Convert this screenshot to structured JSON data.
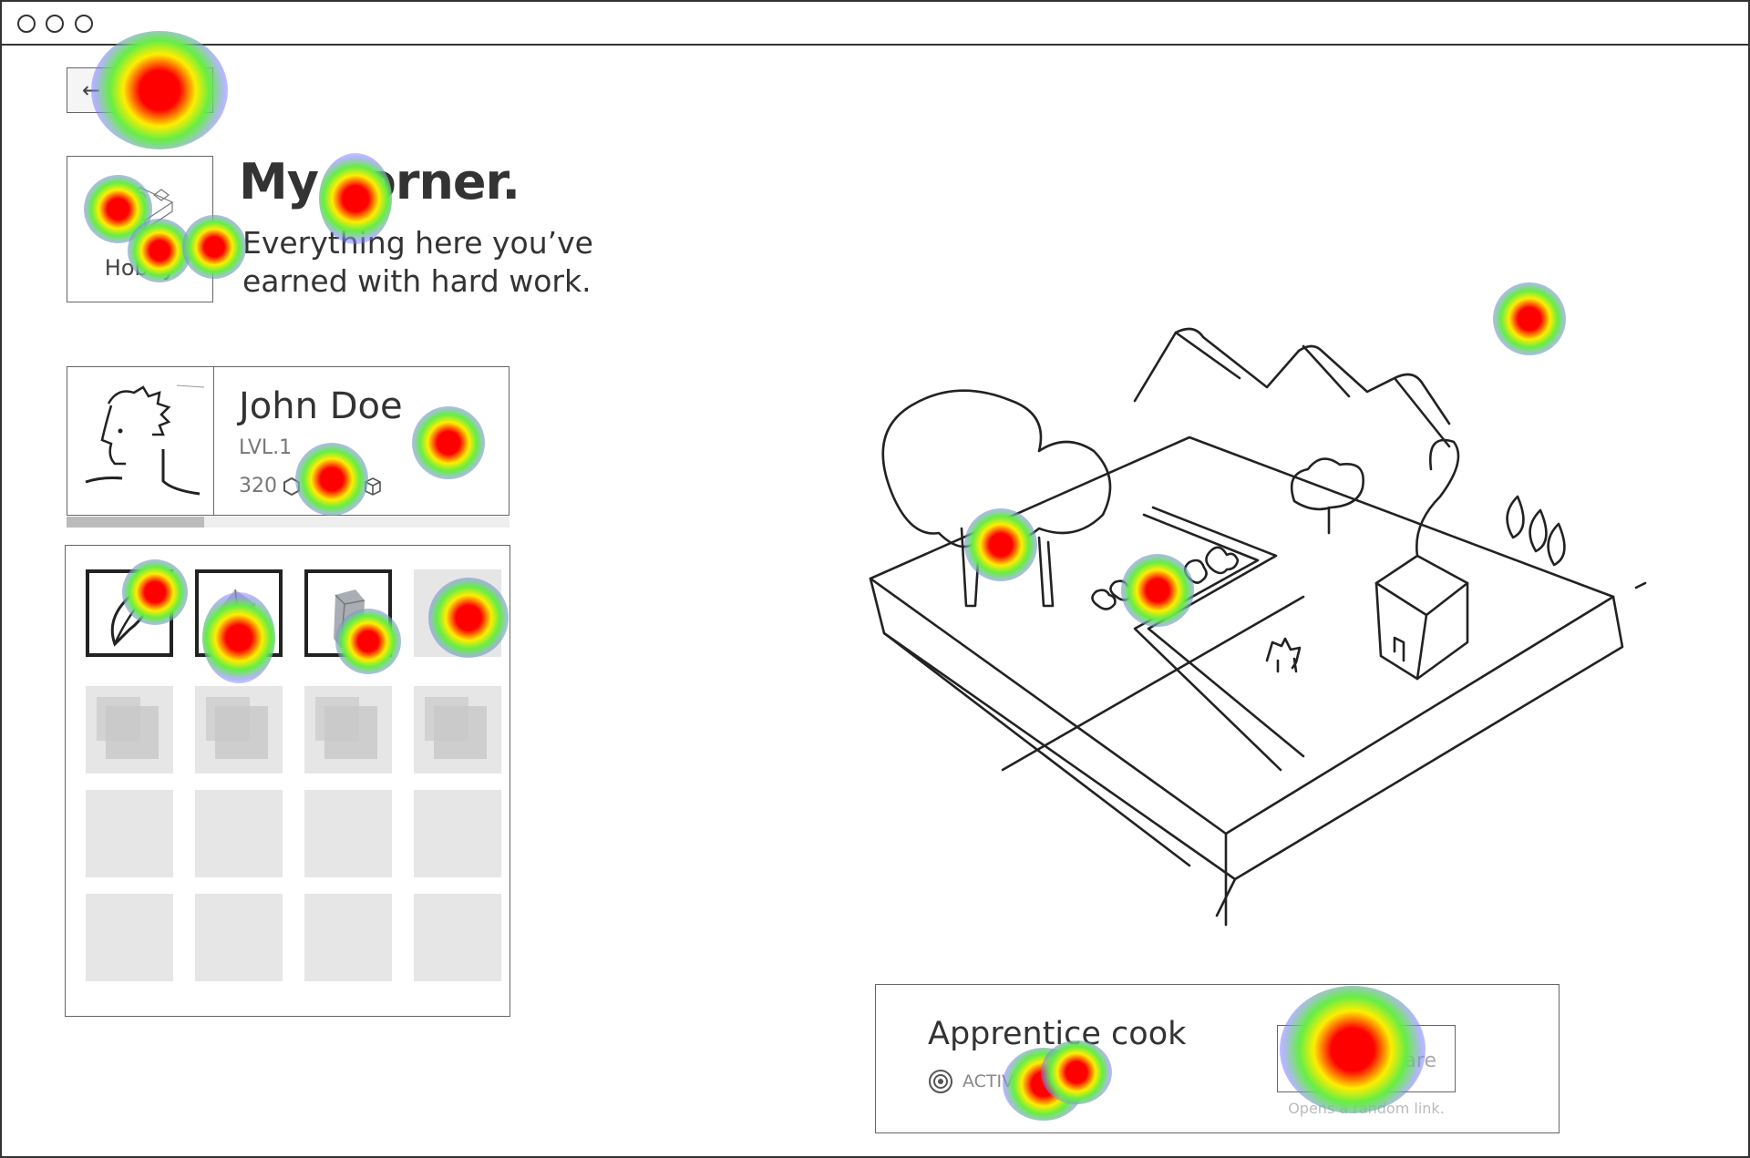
{
  "window": {
    "controls": [
      "circle",
      "circle",
      "circle"
    ]
  },
  "back_button": {
    "icon": "arrow-left-icon",
    "label": "←"
  },
  "hobby_card": {
    "label": "Hobby",
    "icon": "hobby-sketch-icon"
  },
  "header": {
    "title": "My corner.",
    "subtitle": "Everything here you’ve earned with hard work."
  },
  "profile": {
    "name": "John Doe",
    "level": "LVL.1",
    "coins": "320",
    "coin_icon": "hexagon-icon",
    "items": "12",
    "items_icon": "cube-icon",
    "xp_progress": 0.31
  },
  "inventory": {
    "slots": [
      {
        "state": "owned",
        "icon": "leaf-icon"
      },
      {
        "state": "owned",
        "icon": "gem-icon"
      },
      {
        "state": "owned",
        "icon": "block-icon"
      },
      {
        "state": "empty"
      },
      {
        "state": "locked"
      },
      {
        "state": "locked"
      },
      {
        "state": "locked"
      },
      {
        "state": "locked"
      },
      {
        "state": "empty"
      },
      {
        "state": "empty"
      },
      {
        "state": "empty"
      },
      {
        "state": "empty"
      },
      {
        "state": "empty"
      },
      {
        "state": "empty"
      },
      {
        "state": "empty"
      },
      {
        "state": "empty"
      }
    ]
  },
  "scene": {
    "description_icon": "isometric-farm-sketch"
  },
  "achievement": {
    "title": "Apprentice cook",
    "status": "ACTIVE TODAY",
    "status_icon": "target-icon",
    "button_label": "Share",
    "button_hint": "Opens a random link."
  },
  "colors": {
    "ink": "#333333",
    "border": "#666666",
    "empty_slot": "#e6e6e6",
    "heat_hot": "#ff0000"
  }
}
